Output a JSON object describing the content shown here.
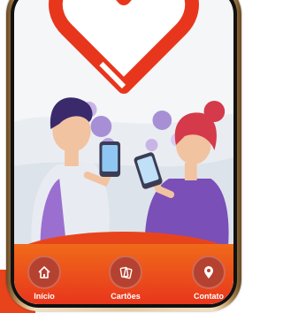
{
  "colors": {
    "heart": "#e8361c",
    "nav_bar": "#e8441c",
    "nav_circle": "#b54230",
    "phone_frame": "#e7c99d"
  },
  "nav": {
    "items": [
      {
        "label": "Início",
        "icon": "home-icon"
      },
      {
        "label": "Cartões",
        "icon": "cards-icon"
      },
      {
        "label": "Contato",
        "icon": "location-pin-icon"
      }
    ]
  }
}
